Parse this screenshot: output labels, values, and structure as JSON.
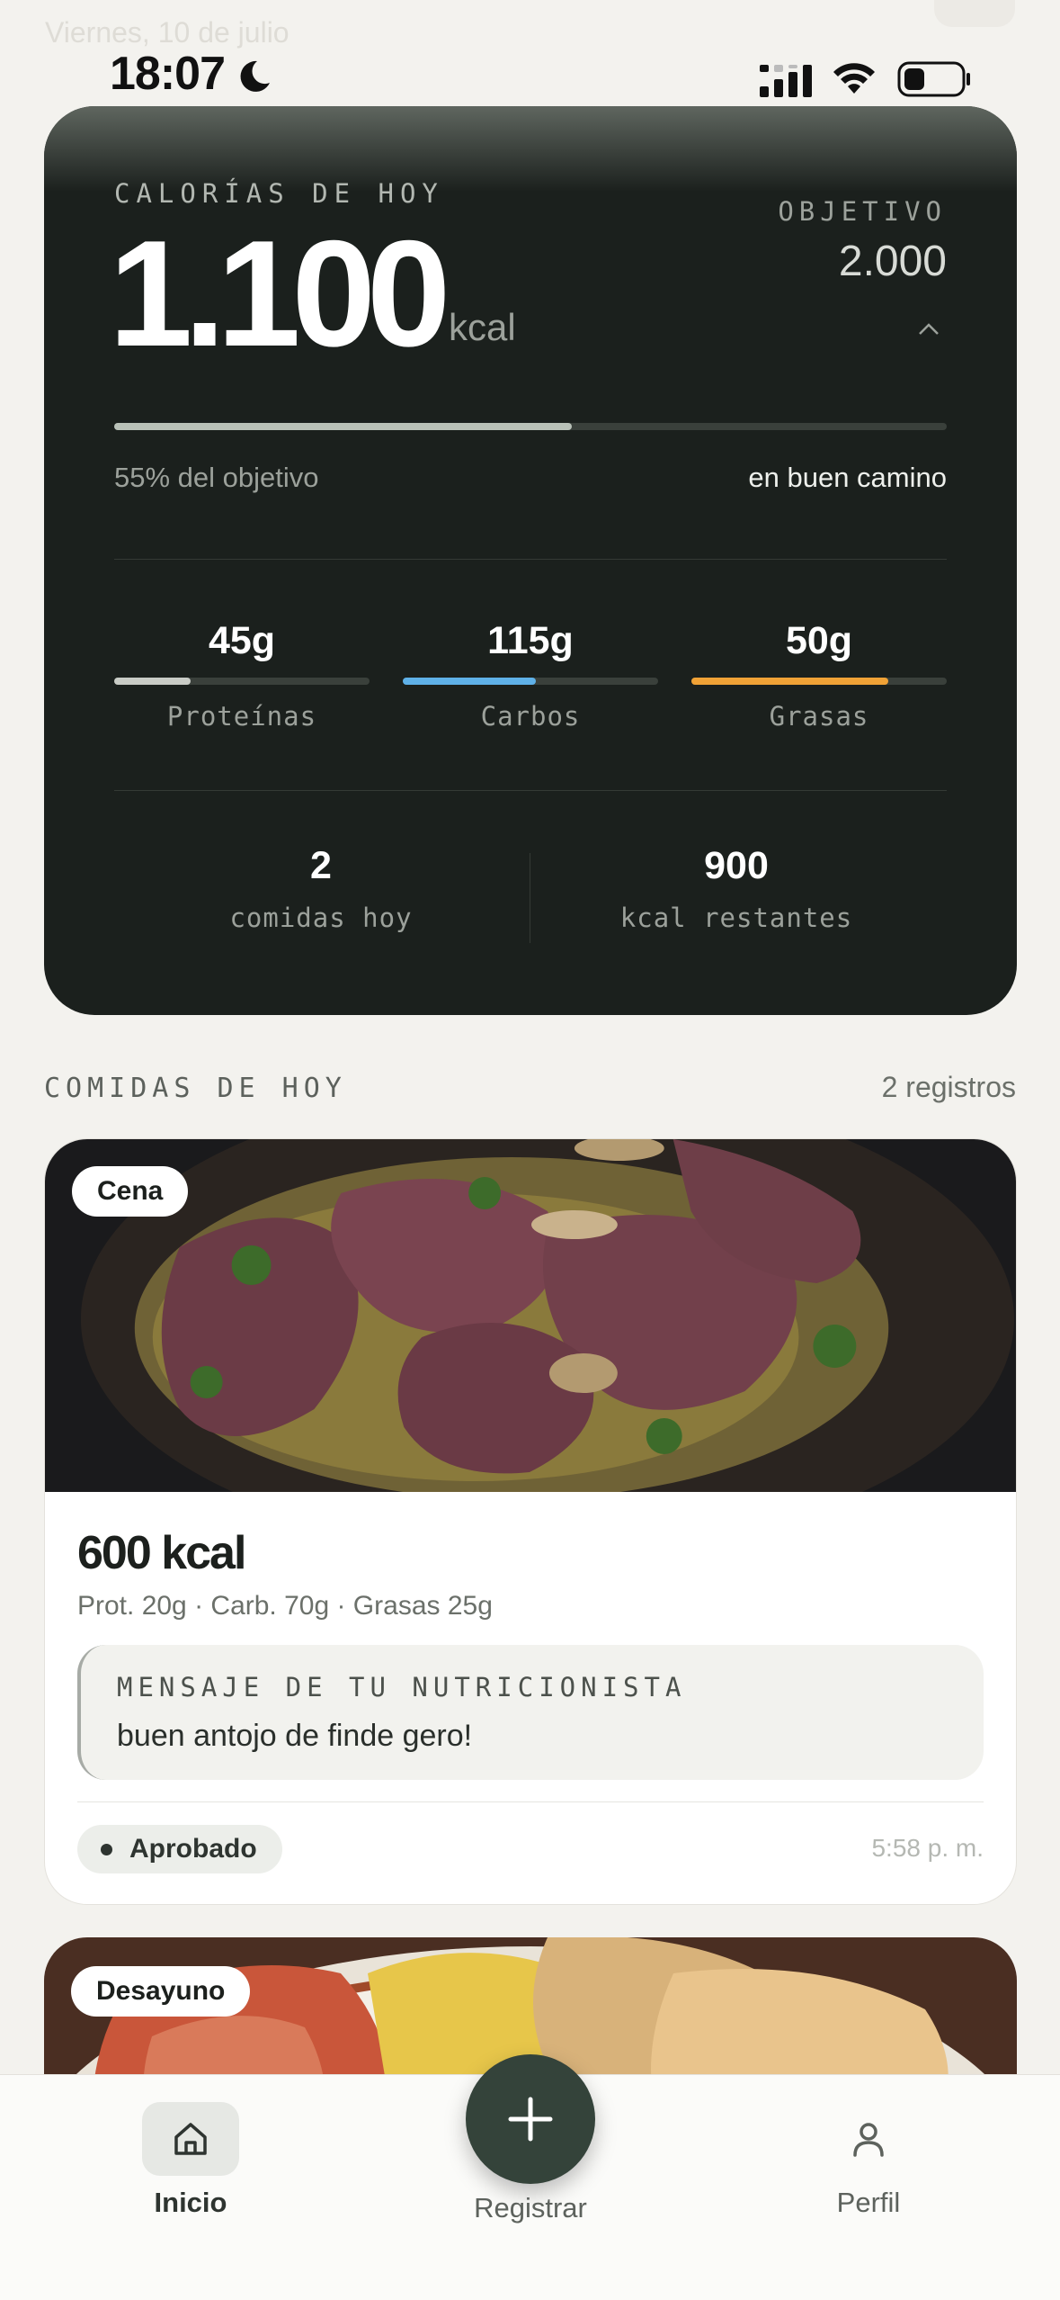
{
  "status_bar": {
    "date_ghost": "Viernes, 10 de julio",
    "time": "18:07"
  },
  "summary": {
    "label": "CALORÍAS DE HOY",
    "value": "1.100",
    "unit": "kcal",
    "goal_label": "OBJETIVO",
    "goal_value": "2.000",
    "progress_fraction": 0.55,
    "progress_text": "55% del objetivo",
    "status_text": "en buen camino",
    "macros": [
      {
        "value": "45g",
        "label": "Proteínas",
        "fraction": 0.3,
        "color": "#c9ccc6"
      },
      {
        "value": "115g",
        "label": "Carbos",
        "fraction": 0.52,
        "color": "#5fb1e8"
      },
      {
        "value": "50g",
        "label": "Grasas",
        "fraction": 0.77,
        "color": "#f0a236"
      }
    ],
    "stats": [
      {
        "value": "2",
        "label": "comidas hoy"
      },
      {
        "value": "900",
        "label": "kcal restantes"
      }
    ]
  },
  "meals_section": {
    "title": "COMIDAS DE HOY",
    "count": "2 registros"
  },
  "meals": [
    {
      "badge": "Cena",
      "kcal": "600 kcal",
      "macros": "Prot. 20g · Carb. 70g · Grasas 25g",
      "message_label": "MENSAJE DE TU NUTRICIONISTA",
      "message": "buen antojo de finde gero!",
      "status": "Aprobado",
      "time": "5:58 p. m."
    },
    {
      "badge": "Desayuno"
    }
  ],
  "nav": {
    "home": "Inicio",
    "register": "Registrar",
    "profile": "Perfil"
  }
}
